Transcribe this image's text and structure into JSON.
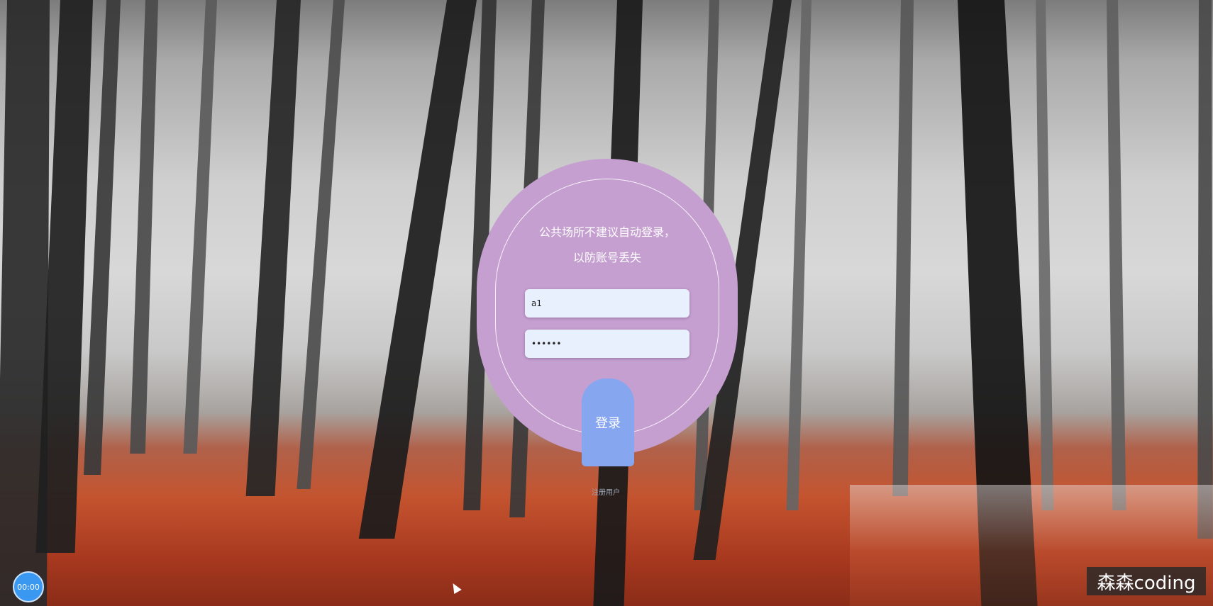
{
  "background": {
    "scene": "misty-forest-background"
  },
  "login": {
    "tip": "公共场所不建议自动登录，以防账号丢失",
    "username_value": "a1",
    "password_value": "••••••",
    "login_label": "登录",
    "register_label": "注册用户"
  },
  "overlay": {
    "timer_label": "00:00",
    "watermark_text": "森森coding"
  },
  "colors": {
    "card": "#c69fd1",
    "button": "#86a6f0",
    "input": "#e8f0fe",
    "timer": "#3a98f0"
  }
}
